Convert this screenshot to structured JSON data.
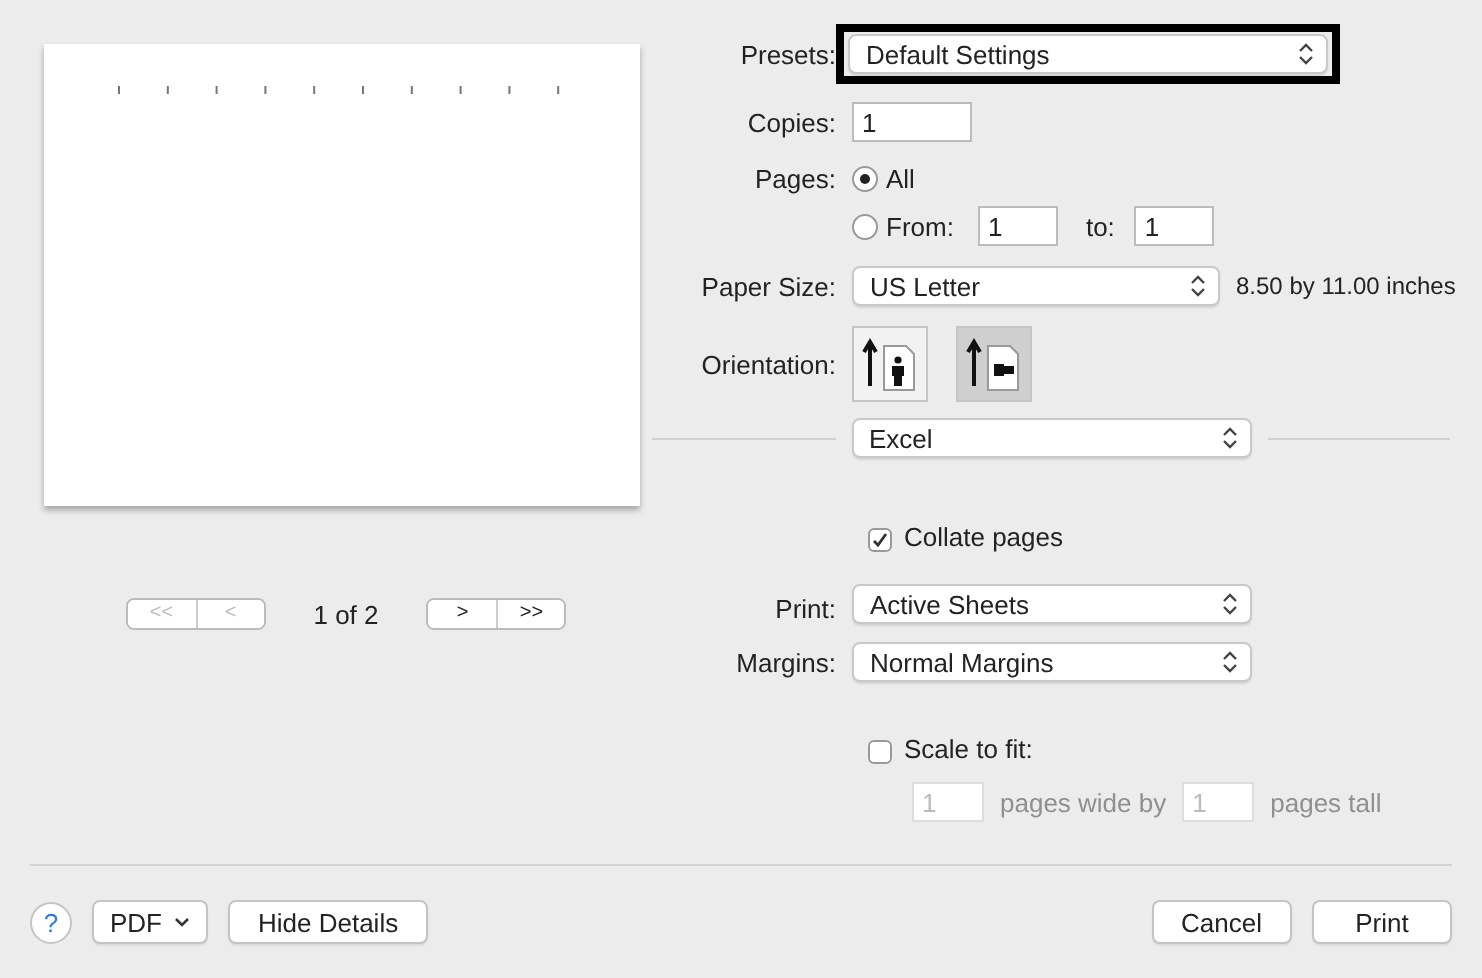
{
  "preview": {
    "nav": [
      {
        "label": "<<",
        "disabled": true
      },
      {
        "label": "<",
        "disabled": true
      }
    ],
    "page_label": "1 of 2",
    "nav_next": [
      {
        "label": ">",
        "disabled": false
      },
      {
        "label": ">>",
        "disabled": false
      }
    ]
  },
  "presets": {
    "label": "Presets:",
    "value": "Default Settings",
    "highlighted": true
  },
  "copies": {
    "label": "Copies:",
    "value": "1"
  },
  "pages": {
    "label": "Pages:",
    "options": [
      {
        "label": "All",
        "selected": true
      },
      {
        "label": "From:",
        "selected": false
      }
    ],
    "from": "1",
    "to_label": "to:",
    "to": "1"
  },
  "paper_size": {
    "label": "Paper Size:",
    "value": "US Letter",
    "dimensions": "8.50 by 11.00 inches"
  },
  "orientation": {
    "label": "Orientation:",
    "options": [
      {
        "kind": "portrait",
        "selected": false
      },
      {
        "kind": "landscape",
        "selected": true
      }
    ]
  },
  "section": {
    "value": "Excel"
  },
  "collate": {
    "label": "Collate pages",
    "checked": true
  },
  "print_what": {
    "label": "Print:",
    "value": "Active Sheets"
  },
  "margins": {
    "label": "Margins:",
    "value": "Normal Margins"
  },
  "scale_to_fit": {
    "label": "Scale to fit:",
    "checked": false,
    "wide": "1",
    "wide_label": "pages wide by",
    "tall": "1",
    "tall_label": "pages tall"
  },
  "footer": {
    "help": "?",
    "pdf": "PDF",
    "hide_details": "Hide Details",
    "cancel": "Cancel",
    "print": "Print"
  }
}
